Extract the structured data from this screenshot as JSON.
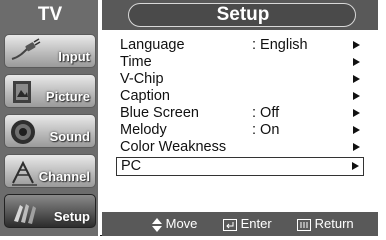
{
  "sidebar": {
    "tv_label": "TV",
    "items": [
      {
        "label": "Input",
        "icon": "input-plug-icon"
      },
      {
        "label": "Picture",
        "icon": "picture-icon"
      },
      {
        "label": "Sound",
        "icon": "speaker-icon"
      },
      {
        "label": "Channel",
        "icon": "antenna-icon"
      },
      {
        "label": "Setup",
        "icon": "setup-icon",
        "active": true
      }
    ]
  },
  "header": {
    "title": "Setup"
  },
  "menu": {
    "items": [
      {
        "name": "Language",
        "value": ": English"
      },
      {
        "name": "Time",
        "value": ""
      },
      {
        "name": "V-Chip",
        "value": ""
      },
      {
        "name": "Caption",
        "value": ""
      },
      {
        "name": "Blue Screen",
        "value": ": Off"
      },
      {
        "name": "Melody",
        "value": ": On"
      },
      {
        "name": "Color Weakness",
        "value": ""
      },
      {
        "name": "PC",
        "value": "",
        "selected": true
      }
    ]
  },
  "footer": {
    "move_label": "Move",
    "enter_label": "Enter",
    "return_label": "Return"
  },
  "colors": {
    "sidebar_bg": "#6c6c6c",
    "header_bg": "#595959",
    "text": "#111111"
  }
}
